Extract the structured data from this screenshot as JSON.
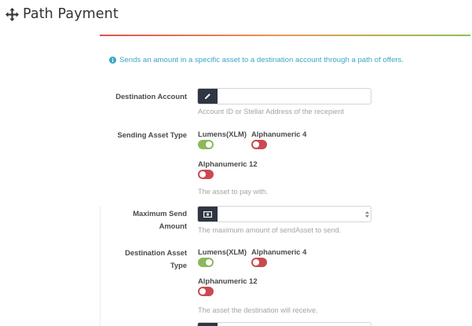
{
  "page": {
    "title": "Path Payment"
  },
  "info": {
    "text": "Sends an amount in a specific asset to a destination account through a path of offers."
  },
  "destination_account": {
    "label": "Destination Account",
    "value": "",
    "placeholder": "",
    "help": "Account ID or Stellar Address of the recepient"
  },
  "sending_asset_type": {
    "label": "Sending Asset Type",
    "options": [
      {
        "label": "Lumens(XLM)",
        "checked": true
      },
      {
        "label": "Alphanumeric 4",
        "checked": false
      },
      {
        "label": "Alphanumeric 12",
        "checked": false
      }
    ],
    "help": "The asset to pay with."
  },
  "maximum_send_amount": {
    "label_line1": "Maximum Send",
    "label_line2": "Amount",
    "value": "",
    "help": "The maximum amount of sendAsset to send."
  },
  "destination_asset_type": {
    "label_line1": "Destination Asset",
    "label_line2": "Type",
    "options": [
      {
        "label": "Lumens(XLM)",
        "checked": true
      },
      {
        "label": "Alphanumeric 4",
        "checked": false
      },
      {
        "label": "Alphanumeric 12",
        "checked": false
      }
    ],
    "help": "The asset the destination will receive."
  },
  "colors": {
    "accent_info": "#3aa6c6",
    "addon_dark": "#2f3542",
    "toggle_on": "#8cb85c",
    "toggle_off": "#c94a4f"
  },
  "icons": {
    "title": "move-arrows-icon",
    "info": "info-circle-icon",
    "destination_addon": "pencil-icon",
    "amount_addon": "money-icon"
  }
}
